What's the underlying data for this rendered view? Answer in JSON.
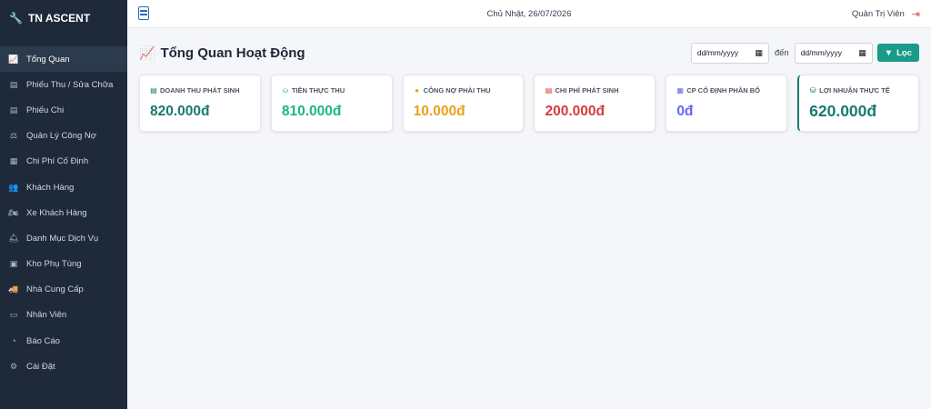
{
  "app": {
    "brand": "TN ASCENT"
  },
  "sidebar": {
    "items": [
      {
        "label": "Tổng Quan",
        "icon": "line-chart-icon",
        "glyph": "📈",
        "active": true
      },
      {
        "label": "Phiếu Thu / Sửa Chữa",
        "icon": "receipt-icon",
        "glyph": "▤"
      },
      {
        "label": "Phiếu Chi",
        "icon": "document-icon",
        "glyph": "▤"
      },
      {
        "label": "Quản Lý Công Nợ",
        "icon": "scale-icon",
        "glyph": "⚖"
      },
      {
        "label": "Chi Phí Cố Định",
        "icon": "calendar-icon",
        "glyph": "▦"
      },
      {
        "label": "Khách Hàng",
        "icon": "users-icon",
        "glyph": "👥"
      },
      {
        "label": "Xe Khách Hàng",
        "icon": "motorcycle-icon",
        "glyph": "🏍"
      },
      {
        "label": "Danh Mục Dịch Vụ",
        "icon": "service-bell-icon",
        "glyph": "🛎"
      },
      {
        "label": "Kho Phụ Tùng",
        "icon": "boxes-icon",
        "glyph": "▣"
      },
      {
        "label": "Nhà Cung Cấp",
        "icon": "truck-icon",
        "glyph": "🚚"
      },
      {
        "label": "Nhân Viên",
        "icon": "id-card-icon",
        "glyph": "▭"
      },
      {
        "label": "Báo Cáo",
        "icon": "pie-chart-icon",
        "glyph": "◔"
      },
      {
        "label": "Cài Đặt",
        "icon": "gear-icon",
        "glyph": "⚙"
      }
    ]
  },
  "topbar": {
    "date": "Chủ Nhật, 26/07/2026",
    "user": "Quản Trị Viên",
    "logout_icon": "sign-out-icon"
  },
  "main": {
    "title": "Tổng Quan Hoạt Động",
    "filter": {
      "from_placeholder": "dd/mm/yyyy",
      "separator": "đến",
      "to_placeholder": "dd/mm/yyyy",
      "button_label": "Lọc"
    },
    "cards": [
      {
        "label": "DOANH THU PHÁT SINH",
        "value": "820.000đ",
        "color": "#1a7a6e",
        "icon": "file-invoice-icon",
        "glyph": "▤"
      },
      {
        "label": "TIỀN THỰC THU",
        "value": "810.000đ",
        "color": "#1fb38b",
        "icon": "hand-money-icon",
        "glyph": "⛀"
      },
      {
        "label": "CÔNG NỢ PHẢI THU",
        "value": "10.000đ",
        "color": "#e8a317",
        "icon": "warning-circle-icon",
        "glyph": "●"
      },
      {
        "label": "CHI PHÍ PHÁT SINH",
        "value": "200.000đ",
        "color": "#d63c3c",
        "icon": "receipt-red-icon",
        "glyph": "▤"
      },
      {
        "label": "CP CỐ ĐỊNH PHÂN BỔ",
        "value": "0đ",
        "color": "#6366f1",
        "icon": "calendar-check-icon",
        "glyph": "▦"
      },
      {
        "label": "LỢI NHUẬN THỰC TẾ",
        "value": "620.000đ",
        "color": "#1a7a6e",
        "icon": "money-bag-icon",
        "glyph": "⛁",
        "highlight": true
      }
    ]
  }
}
